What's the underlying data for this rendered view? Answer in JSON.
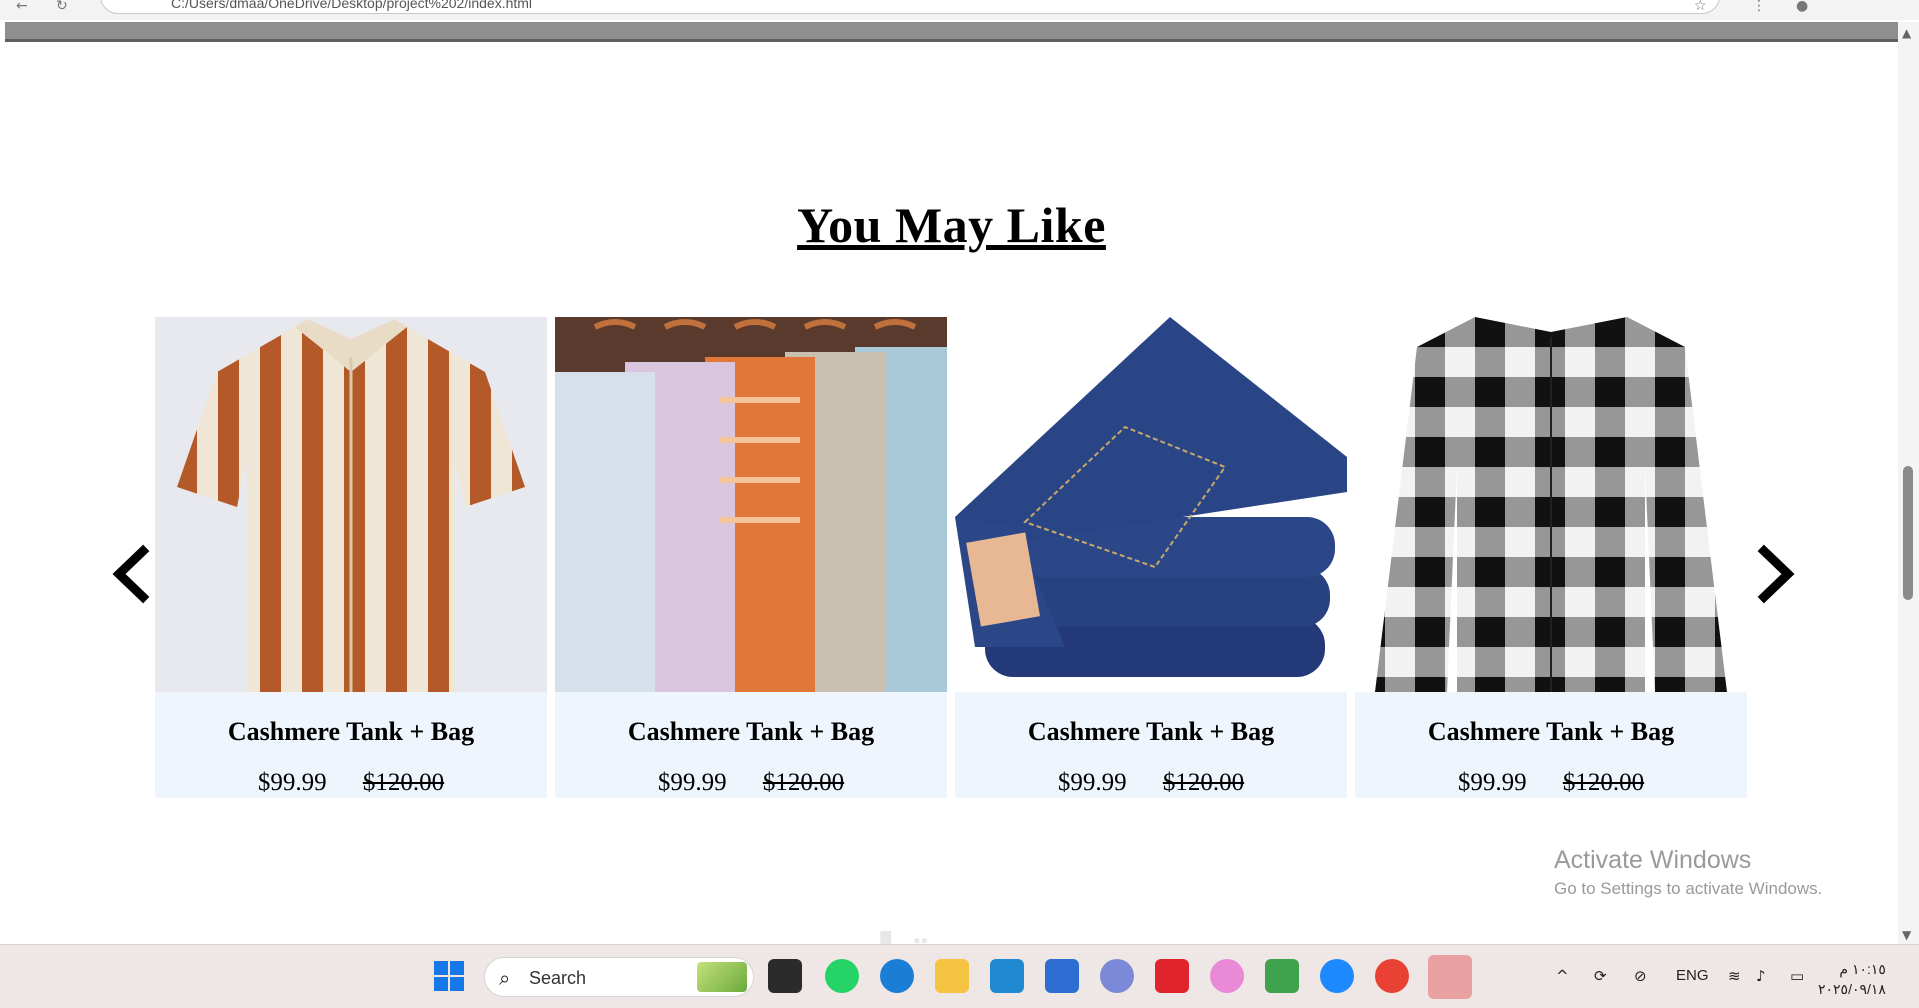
{
  "browser": {
    "address": "C:/Users/dmaa/OneDrive/Desktop/project%202/index.html"
  },
  "section": {
    "title": "You May Like"
  },
  "products": [
    {
      "image": "striped-knit-shirt",
      "name": "Cashmere Tank + Bag",
      "price": "$99.99",
      "old_price": "$120.00"
    },
    {
      "image": "hanging-shirts",
      "name": "Cashmere Tank + Bag",
      "price": "$99.99",
      "old_price": "$120.00"
    },
    {
      "image": "folded-jeans",
      "name": "Cashmere Tank + Bag",
      "price": "$99.99",
      "old_price": "$120.00"
    },
    {
      "image": "plaid-shirt",
      "name": "Cashmere Tank + Bag",
      "price": "$99.99",
      "old_price": "$120.00"
    }
  ],
  "watermark": {
    "line1": "Activate Windows",
    "line2": "Go to Settings to activate Windows.",
    "site": "مستقل"
  },
  "taskbar": {
    "search_label": "Search",
    "language": "ENG",
    "time": "١٠:١٥ م",
    "date": "٢٠٢٥/٠٩/١٨"
  },
  "colors": {
    "card_bg": "#eef5fc",
    "taskbar_bg": "#efe6e6"
  }
}
